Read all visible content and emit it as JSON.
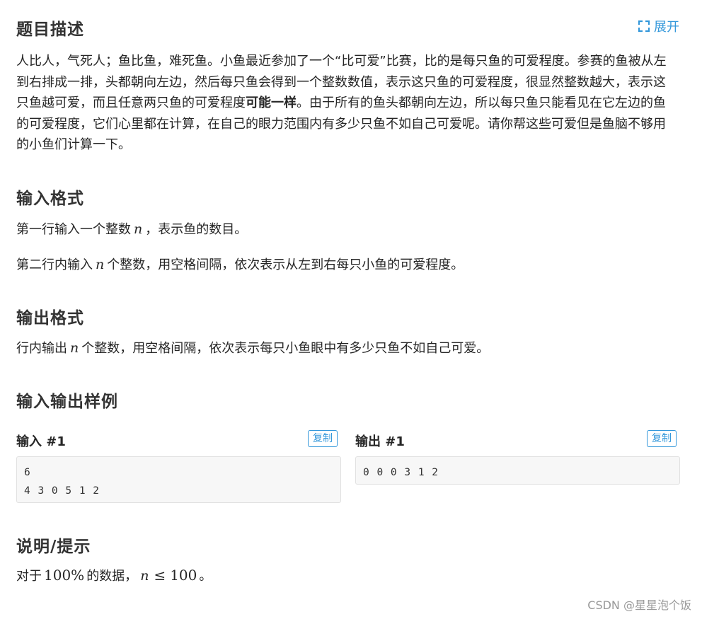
{
  "description": {
    "title": "题目描述",
    "expand_label": "展开",
    "text_part1": "人比人，气死人；鱼比鱼，难死鱼。小鱼最近参加了一个“比可爱”比赛，比的是每只鱼的可爱程度。参赛的鱼被从左到右排成一排，头都朝向左边，然后每只鱼会得到一个整数数值，表示这只鱼的可爱程度，很显然整数越大，表示这只鱼越可爱，而且任意两只鱼的可爱程度",
    "text_bold": "可能一样",
    "text_part2": "。由于所有的鱼头都朝向左边，所以每只鱼只能看见在它左边的鱼的可爱程度，它们心里都在计算，在自己的眼力范围内有多少只鱼不如自己可爱呢。请你帮这些可爱但是鱼脑不够用的小鱼们计算一下。"
  },
  "input_format": {
    "title": "输入格式",
    "line1_before": "第一行输入一个整数",
    "line1_var": "n",
    "line1_after": "，表示鱼的数目。",
    "line2_before": "第二行内输入",
    "line2_var": "n",
    "line2_after": "个整数，用空格间隔，依次表示从左到右每只小鱼的可爱程度。"
  },
  "output_format": {
    "title": "输出格式",
    "line_before": "行内输出",
    "line_var": "n",
    "line_after": "个整数，用空格间隔，依次表示每只小鱼眼中有多少只鱼不如自己可爱。"
  },
  "samples": {
    "title": "输入输出样例",
    "input_label": "输入 #1",
    "output_label": "输出 #1",
    "copy_label": "复制",
    "input_line1": "6",
    "input_line2": "4 3 0 5 1 2",
    "output_line1": "0 0 0 3 1 2"
  },
  "hint": {
    "title": "说明/提示",
    "before": "对于",
    "percent": "100%",
    "middle": "的数据，",
    "var": "n",
    "leq": "≤",
    "limit": "100",
    "after": "。"
  },
  "watermark": "CSDN @星星泡个饭",
  "colors": {
    "accent": "#3498db",
    "code_bg": "#f7f7f7",
    "watermark": "#999999"
  }
}
